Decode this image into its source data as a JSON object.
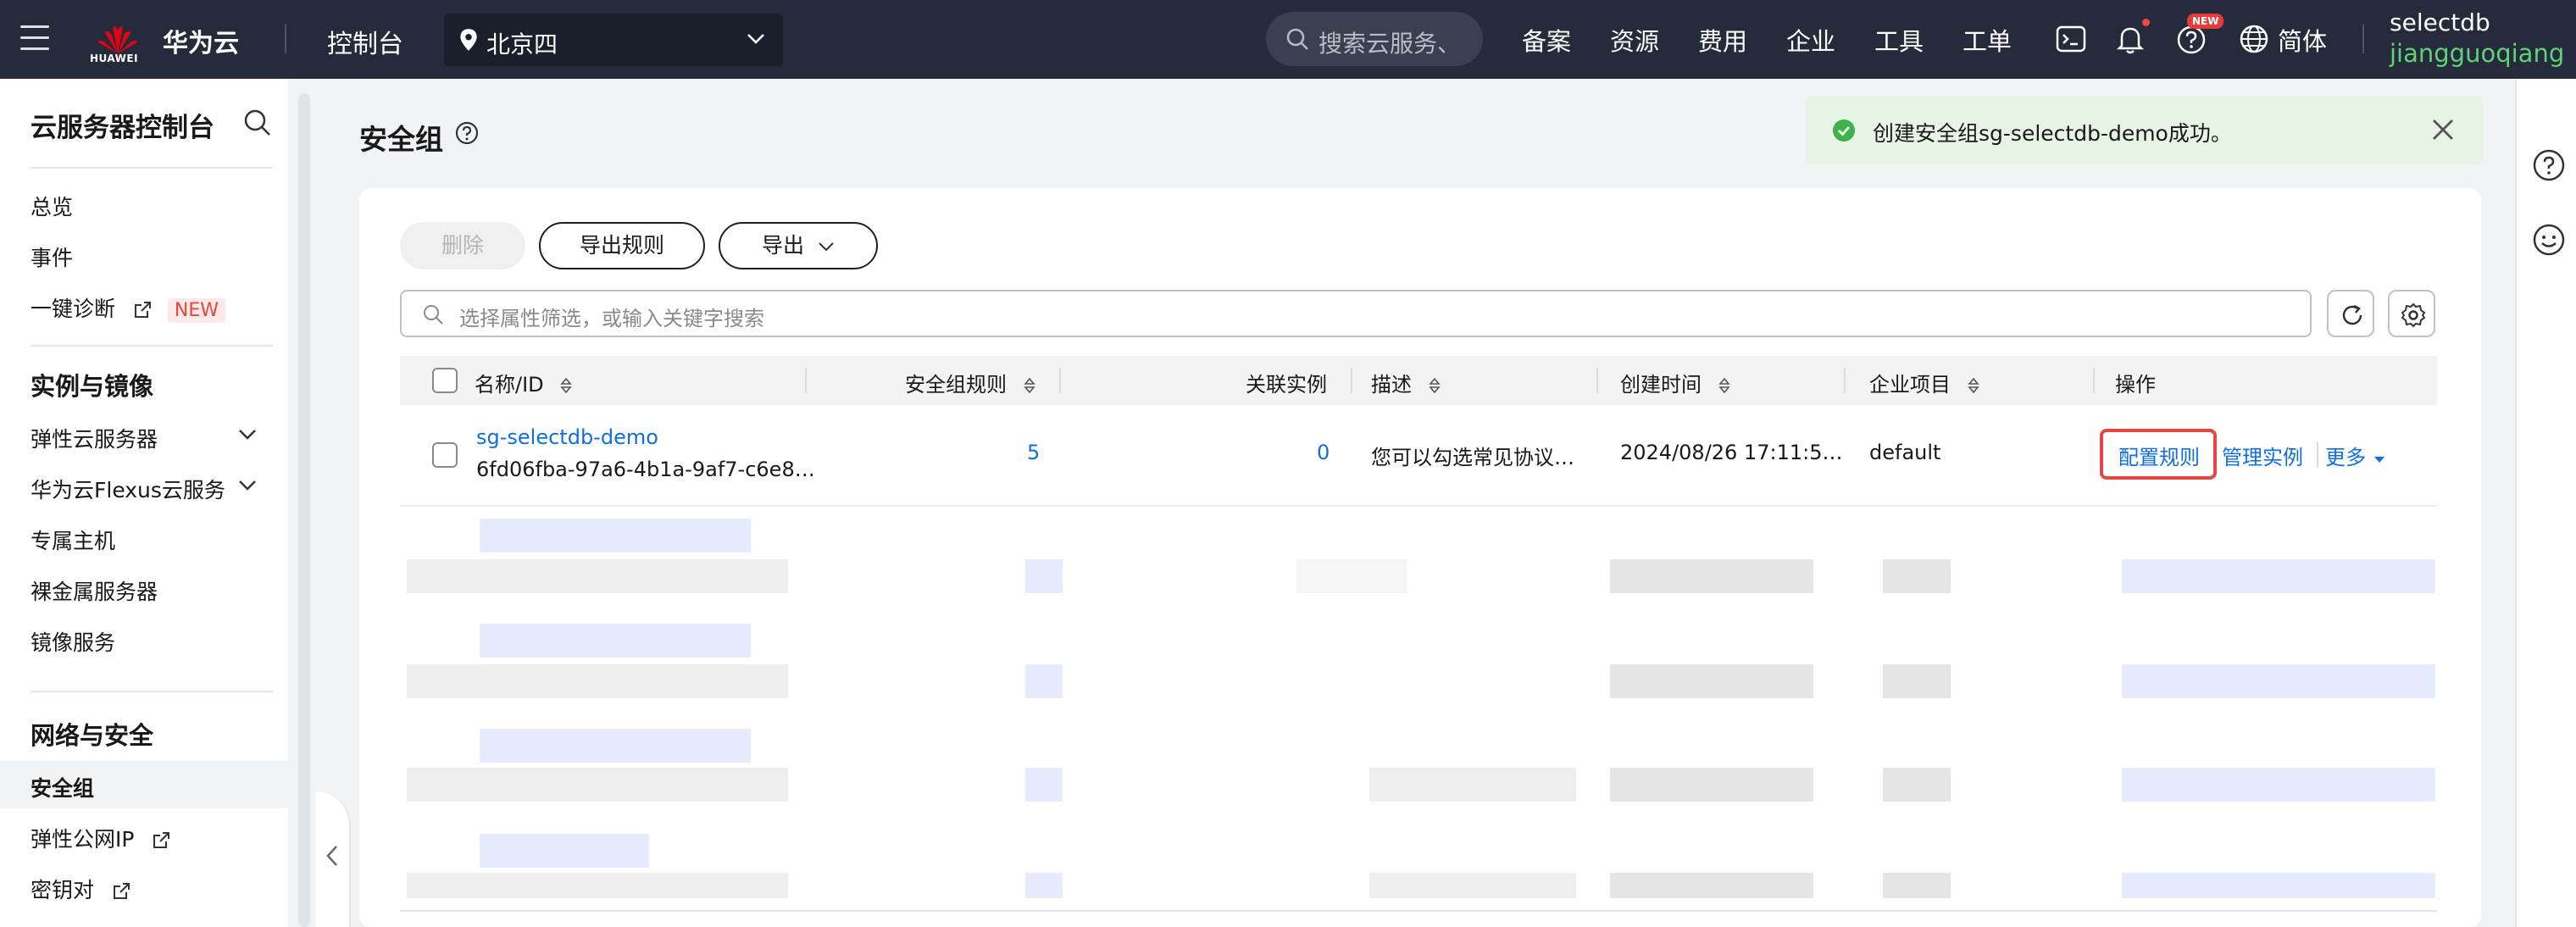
{
  "topbar": {
    "brand": "华为云",
    "logo_text": "HUAWEI",
    "console": "控制台",
    "region": "北京四",
    "search_placeholder": "搜索云服务、",
    "nav": [
      "备案",
      "资源",
      "费用",
      "企业",
      "工具",
      "工单"
    ],
    "new_badge": "NEW",
    "language": "简体",
    "account": "selectdb",
    "user": "jiangguoqiang"
  },
  "sidebar": {
    "title": "云服务器控制台",
    "items_top": [
      "总览",
      "事件",
      "一键诊断"
    ],
    "new_tag": "NEW",
    "group1": "实例与镜像",
    "group1_items": [
      "弹性云服务器",
      "华为云Flexus云服务",
      "专属主机",
      "裸金属服务器",
      "镜像服务"
    ],
    "group2": "网络与安全",
    "group2_items": [
      "安全组",
      "弹性公网IP",
      "密钥对"
    ],
    "active": "安全组"
  },
  "page": {
    "title": "安全组"
  },
  "toolbar": {
    "delete": "删除",
    "export_rules": "导出规则",
    "export": "导出",
    "filter_placeholder": "选择属性筛选，或输入关键字搜索"
  },
  "table": {
    "headers": [
      "名称/ID",
      "安全组规则",
      "关联实例",
      "描述",
      "创建时间",
      "企业项目",
      "操作"
    ],
    "rows": [
      {
        "name": "sg-selectdb-demo",
        "id": "6fd06fba-97a6-4b1a-9af7-c6e8…",
        "rules": "5",
        "instances": "0",
        "description": "您可以勾选常见协议…",
        "created": "2024/08/26 17:11:5…",
        "project": "default",
        "actions": [
          "配置规则",
          "管理实例",
          "更多"
        ]
      }
    ]
  },
  "toast": {
    "message": "创建安全组sg-selectdb-demo成功。"
  },
  "colors": {
    "topbar": "#252b3a",
    "link": "#0f6fde",
    "highlight": "#e64545",
    "success": "#3fb24a"
  }
}
